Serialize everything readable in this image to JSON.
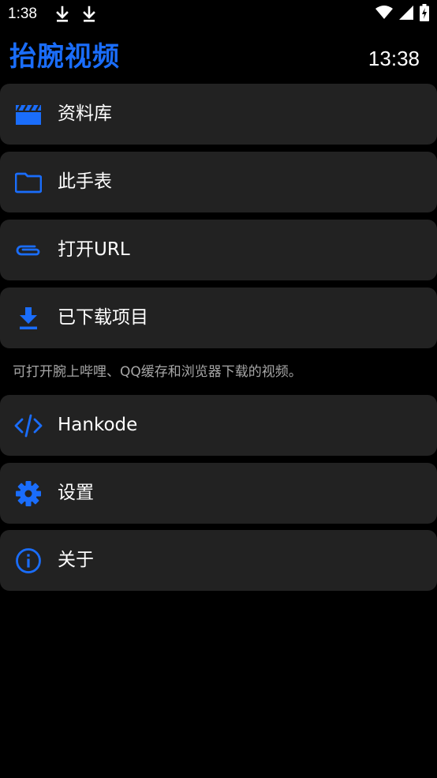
{
  "status_bar": {
    "time": "1:38",
    "download_icons": [
      "download-icon",
      "download-icon"
    ],
    "right_icons": [
      "wifi-icon",
      "signal-icon",
      "battery-charging-icon"
    ]
  },
  "header": {
    "title": "抬腕视频",
    "clock": "13:38"
  },
  "menu": {
    "items": [
      {
        "label": "资料库",
        "icon": "clapperboard-icon"
      },
      {
        "label": "此手表",
        "icon": "folder-icon"
      },
      {
        "label": "打开URL",
        "icon": "link-icon"
      },
      {
        "label": "已下载项目",
        "icon": "download-icon"
      }
    ],
    "hint": "可打开腕上哔哩、QQ缓存和浏览器下载的视频。",
    "items2": [
      {
        "label": "Hankode",
        "icon": "code-icon"
      },
      {
        "label": "设置",
        "icon": "gear-icon"
      },
      {
        "label": "关于",
        "icon": "info-icon"
      }
    ]
  },
  "colors": {
    "accent": "#1a6dfb",
    "card_background": "#222222",
    "page_background": "#000000",
    "hint_text": "#a6a6a6"
  }
}
